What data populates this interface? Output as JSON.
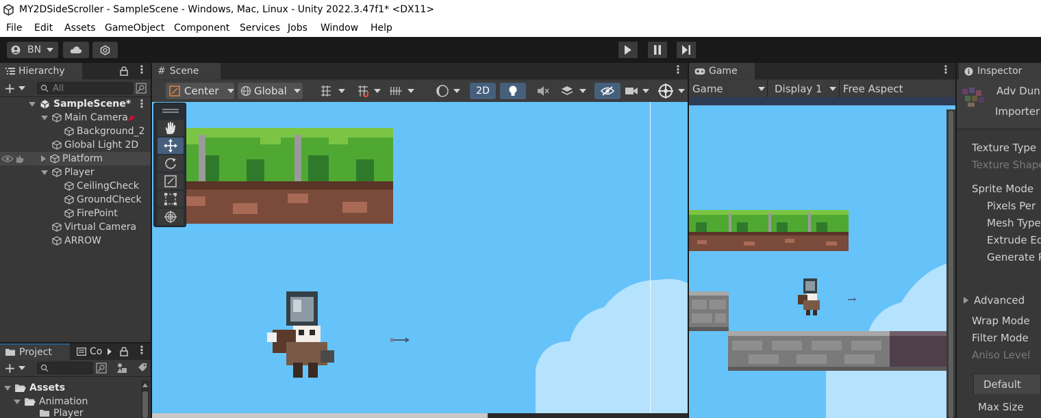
{
  "window": {
    "title": "MY2DSideScroller - SampleScene - Windows, Mac, Linux - Unity 2022.3.47f1* <DX11>"
  },
  "menu": [
    "File",
    "Edit",
    "Assets",
    "GameObject",
    "Component",
    "Services",
    "Jobs",
    "Window",
    "Help"
  ],
  "toolbar": {
    "account": "BN"
  },
  "hierarchy": {
    "tab": "Hierarchy",
    "search_placeholder": "All",
    "scene": "SampleScene*",
    "items": [
      {
        "label": "Main Camera"
      },
      {
        "label": "Background_2"
      },
      {
        "label": "Global Light 2D"
      },
      {
        "label": "Platform"
      },
      {
        "label": "Player"
      },
      {
        "label": "CeilingCheck"
      },
      {
        "label": "GroundCheck"
      },
      {
        "label": "FirePoint"
      },
      {
        "label": "Virtual Camera"
      },
      {
        "label": "ARROW"
      }
    ]
  },
  "scene_view": {
    "tab": "Scene",
    "pivot": "Center",
    "space": "Global",
    "mode_2d": "2D"
  },
  "game_view": {
    "tab": "Game",
    "mode": "Game",
    "display": "Display 1",
    "aspect": "Free Aspect"
  },
  "project": {
    "tab": "Project",
    "tab2": "Co",
    "folders": [
      {
        "label": "Assets"
      },
      {
        "label": "Animation"
      },
      {
        "label": "Player"
      }
    ]
  },
  "inspector": {
    "tab": "Inspector",
    "asset_name": "Adv Dun",
    "asset_type": "Importer",
    "fields": [
      {
        "label": "Texture Type"
      },
      {
        "label": "Texture Shape"
      },
      {
        "label": "Sprite Mode"
      },
      {
        "label": "Pixels Per"
      },
      {
        "label": "Mesh Type"
      },
      {
        "label": "Extrude Ed"
      },
      {
        "label": "Generate P"
      },
      {
        "label": "Advanced"
      },
      {
        "label": "Wrap Mode"
      },
      {
        "label": "Filter Mode"
      },
      {
        "label": "Aniso Level"
      },
      {
        "label": "Default"
      },
      {
        "label": "Max Size"
      }
    ]
  },
  "colors": {
    "sky": "#65c3fa",
    "panel": "#383838",
    "accent": "#2c5d87",
    "grass": "#4fa832"
  }
}
